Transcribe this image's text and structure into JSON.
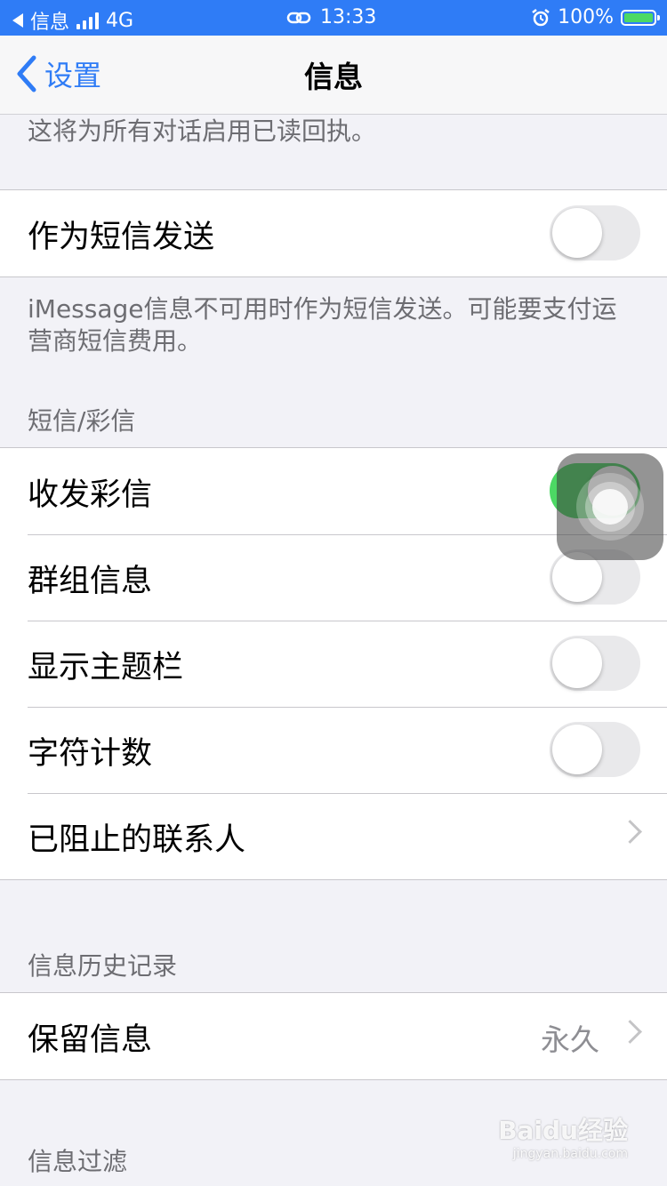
{
  "status_bar": {
    "back_app": "信息",
    "carrier": "4G",
    "time": "13:33",
    "battery": "100%"
  },
  "nav": {
    "back_label": "设置",
    "title": "信息"
  },
  "read_receipt_note": "这将为所有对话启用已读回执。",
  "send_as_sms": {
    "label": "作为短信发送",
    "on": false,
    "note": "iMessage信息不可用时作为短信发送。可能要支付运营商短信费用。"
  },
  "sms_mms_section": {
    "header": "短信/彩信",
    "items": [
      {
        "label": "收发彩信",
        "on": true
      },
      {
        "label": "群组信息",
        "on": false
      },
      {
        "label": "显示主题栏",
        "on": false
      },
      {
        "label": "字符计数",
        "on": false
      },
      {
        "label": "已阻止的联系人"
      }
    ]
  },
  "history_section": {
    "header": "信息历史记录",
    "keep_messages": {
      "label": "保留信息",
      "value": "永久"
    }
  },
  "filter_section": {
    "header": "信息过滤"
  },
  "watermark": {
    "brand": "Baidu经验",
    "url": "jingyan.baidu.com"
  },
  "colors": {
    "accent": "#2f7cf6",
    "toggle_on": "#4cd964",
    "toggle_off": "#e9e9eb"
  }
}
